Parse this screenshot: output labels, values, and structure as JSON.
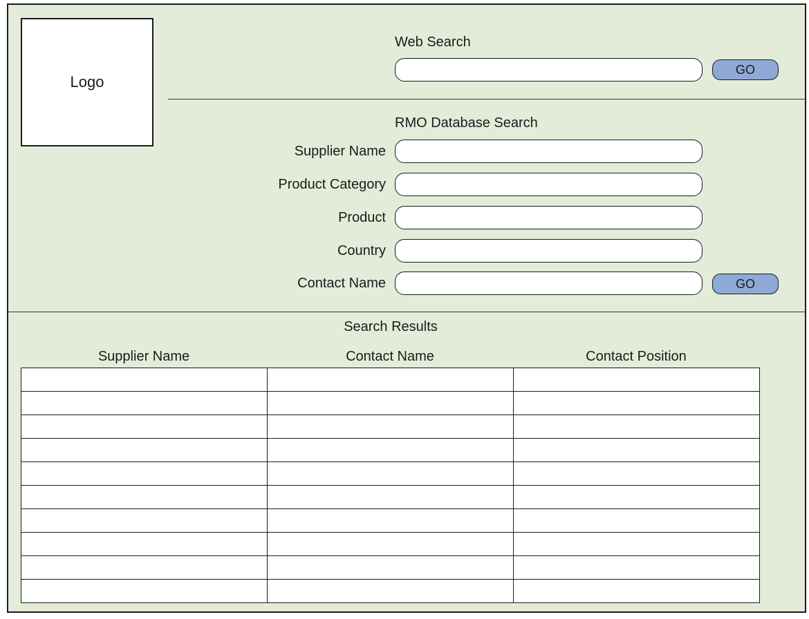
{
  "logo": {
    "text": "Logo"
  },
  "web_search": {
    "title": "Web Search",
    "input_value": "",
    "go_label": "GO"
  },
  "db_search": {
    "title": "RMO Database Search",
    "fields": [
      {
        "label": "Supplier Name",
        "value": ""
      },
      {
        "label": "Product Category",
        "value": ""
      },
      {
        "label": "Product",
        "value": ""
      },
      {
        "label": "Country",
        "value": ""
      },
      {
        "label": "Contact Name",
        "value": ""
      }
    ],
    "go_label": "GO"
  },
  "results": {
    "title": "Search Results",
    "columns": [
      "Supplier Name",
      "Contact Name",
      "Contact Position"
    ],
    "rows": [
      [
        "",
        "",
        ""
      ],
      [
        "",
        "",
        ""
      ],
      [
        "",
        "",
        ""
      ],
      [
        "",
        "",
        ""
      ],
      [
        "",
        "",
        ""
      ],
      [
        "",
        "",
        ""
      ],
      [
        "",
        "",
        ""
      ],
      [
        "",
        "",
        ""
      ],
      [
        "",
        "",
        ""
      ],
      [
        "",
        "",
        ""
      ]
    ]
  },
  "colors": {
    "background": "#e3ecd9",
    "go_button": "#8fa9d6",
    "field": "#ffffff",
    "border": "#1a1a1a"
  }
}
